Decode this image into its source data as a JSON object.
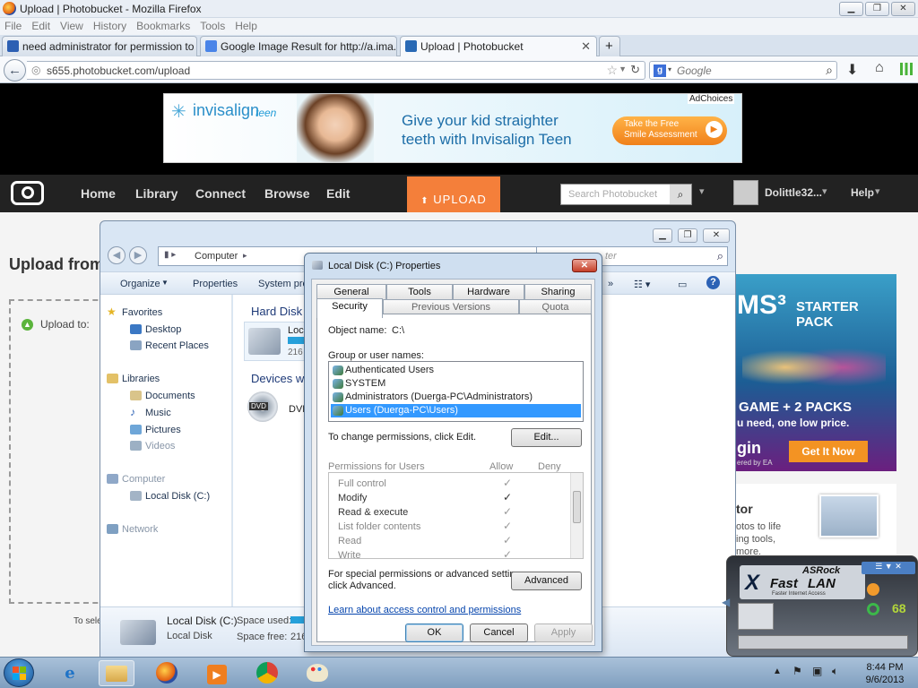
{
  "browser": {
    "window_title": "Upload | Photobucket - Mozilla Firefox",
    "menu": [
      "File",
      "Edit",
      "View",
      "History",
      "Bookmarks",
      "Tools",
      "Help"
    ],
    "tabs": [
      {
        "label": "need administrator for permission to ...",
        "color": "#2c5fb3"
      },
      {
        "label": "Google Image Result for http://a.ima...",
        "color": "#4a84e8"
      },
      {
        "label": "Upload | Photobucket",
        "color": "#2a6ab5"
      }
    ],
    "url": "s655.photobucket.com/upload",
    "search_placeholder": "Google",
    "search_engine_letter": "g"
  },
  "ad": {
    "brand": "invisalign",
    "brand_suffix": "teen",
    "headline_1": "Give your  kid straighter",
    "headline_2": "teeth with Invisalign Teen",
    "cta_1": "Take the Free",
    "cta_2": "Smile Assessment",
    "adchoices": "AdChoices"
  },
  "photobucket": {
    "nav": [
      "Home",
      "Library",
      "Connect",
      "Browse",
      "Edit"
    ],
    "upload": "UPLOAD",
    "search_placeholder": "Search Photobucket",
    "user": "Dolittle32...",
    "help": "Help",
    "page_title": "Upload from",
    "upload_to": "Upload to:",
    "footer_text": "To sele"
  },
  "sims_ad": {
    "headline": "STARTER PACK",
    "line1": "GAME + 2 PACKS",
    "line2": "u need, one low price.",
    "cta": "Get It Now",
    "partial": "gin",
    "partial2": "ered by EA"
  },
  "right_promo": {
    "title": "tor",
    "line1": "otos to life",
    "line2": "ing tools,",
    "line3": "more."
  },
  "explorer": {
    "address": "Computer",
    "search_placeholder": "ter",
    "toolbar": [
      "Organize",
      "Properties",
      "System pro"
    ],
    "sidebar": {
      "favorites": "Favorites",
      "fav_items": [
        "Desktop",
        "Recent Places"
      ],
      "libraries": "Libraries",
      "lib_items": [
        "Documents",
        "Music",
        "Pictures",
        "Videos"
      ],
      "computer": "Computer",
      "comp_items": [
        "Local Disk (C:)"
      ],
      "network": "Network"
    },
    "sections": [
      "Hard Disk",
      "Devices wi"
    ],
    "drive_label": "Loc",
    "drive_size": "216",
    "dvd_label": "DVD",
    "dvd_badge": "DVD",
    "status": {
      "name": "Local Disk (C:)",
      "type": "Local Disk",
      "used_label": "Space used:",
      "free_label": "Space free:",
      "free_value": "216"
    }
  },
  "dialog": {
    "title": "Local Disk (C:) Properties",
    "tabs_row1": [
      "General",
      "Tools",
      "Hardware",
      "Sharing"
    ],
    "tabs_row2": [
      "Security",
      "Previous Versions",
      "Quota"
    ],
    "object_name_label": "Object name:",
    "object_name_value": "C:\\",
    "groups_label": "Group or user names:",
    "groups": [
      "Authenticated Users",
      "SYSTEM",
      "Administrators (Duerga-PC\\Administrators)",
      "Users (Duerga-PC\\Users)"
    ],
    "change_text": "To change permissions, click Edit.",
    "edit_btn": "Edit...",
    "perm_header": "Permissions for Users",
    "allow": "Allow",
    "deny": "Deny",
    "permissions": [
      {
        "name": "Full control",
        "allow": "✓"
      },
      {
        "name": "Modify",
        "allow": "✓"
      },
      {
        "name": "Read & execute",
        "allow": "✓"
      },
      {
        "name": "List folder contents",
        "allow": "✓"
      },
      {
        "name": "Read",
        "allow": "✓"
      },
      {
        "name": "Write",
        "allow": "✓"
      }
    ],
    "special_1": "For special permissions or advanced settings,",
    "special_2": "click Advanced.",
    "advanced_btn": "Advanced",
    "link": "Learn about access control and permissions",
    "ok": "OK",
    "cancel": "Cancel",
    "apply": "Apply"
  },
  "asrock": {
    "brand": "ASRock",
    "product_1": "Fast",
    "product_2": "LAN",
    "tagline": "Faster Internet Access",
    "value": "68"
  },
  "taskbar": {
    "time": "8:44 PM",
    "date": "9/6/2013"
  }
}
